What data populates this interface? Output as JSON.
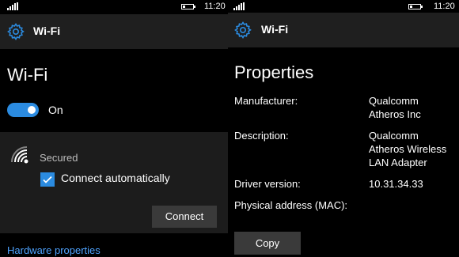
{
  "status_bar": {
    "time": "11:20",
    "battery_level": 0.2
  },
  "left": {
    "header_title": "Wi-Fi",
    "page_title": "Wi-Fi",
    "toggle": {
      "state": "On",
      "label": "On"
    },
    "network": {
      "security": "Secured",
      "connect_auto_label": "Connect automatically",
      "connect_auto_checked": true,
      "connect_button": "Connect"
    },
    "hardware_link": "Hardware properties"
  },
  "right": {
    "header_title": "Wi-Fi",
    "page_title": "Properties",
    "properties": [
      {
        "label": "Manufacturer:",
        "value": "Qualcomm\nAtheros Inc"
      },
      {
        "label": "Description:",
        "value": "Qualcomm\nAtheros Wireless\nLAN Adapter"
      },
      {
        "label": "Driver version:",
        "value": "10.31.34.33"
      },
      {
        "label": "Physical address (MAC):",
        "value": ""
      }
    ],
    "copy_button": "Copy"
  },
  "colors": {
    "accent": "#2b8be0",
    "link": "#4ea3ff",
    "header_bg": "#1f1f1f",
    "card_bg": "#1c1c1c",
    "button_bg": "#3a3a3a"
  },
  "icons": {
    "settings": "gear-icon",
    "wifi": "wifi-icon",
    "signal": "signal-strength-icon",
    "battery": "battery-icon"
  }
}
